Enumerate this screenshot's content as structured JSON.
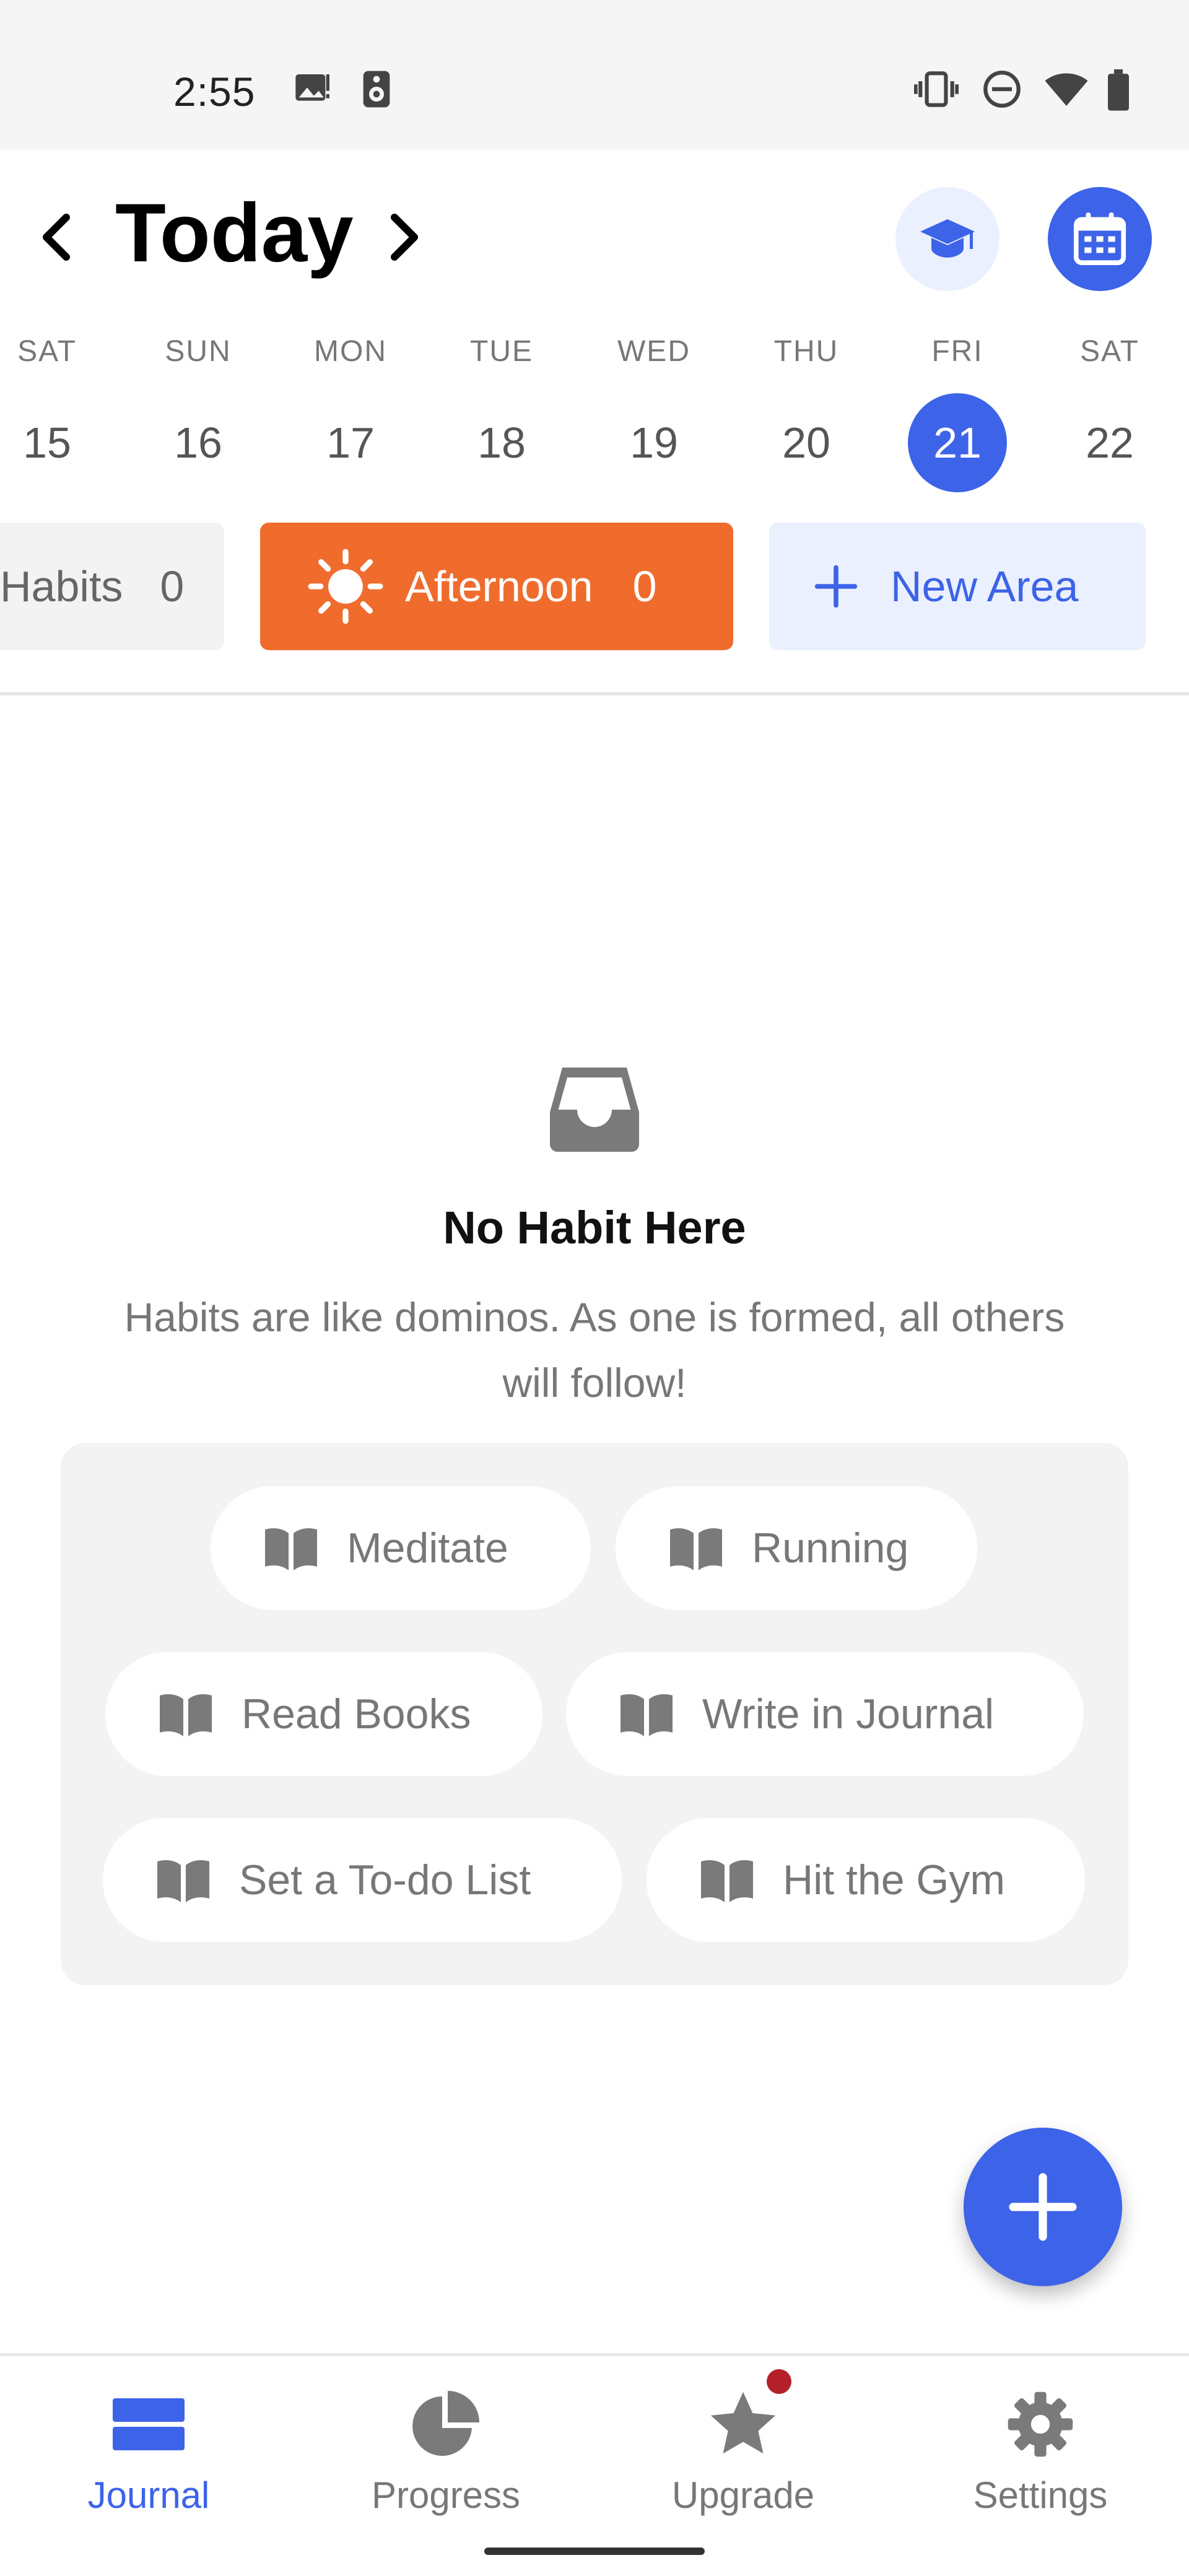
{
  "status_bar": {
    "time": "2:55"
  },
  "header": {
    "title": "Today"
  },
  "week": [
    {
      "name": "SAT",
      "num": "15"
    },
    {
      "name": "SUN",
      "num": "16"
    },
    {
      "name": "MON",
      "num": "17"
    },
    {
      "name": "TUE",
      "num": "18"
    },
    {
      "name": "WED",
      "num": "19"
    },
    {
      "name": "THU",
      "num": "20"
    },
    {
      "name": "FRI",
      "num": "21",
      "selected": true
    },
    {
      "name": "SAT",
      "num": "22"
    }
  ],
  "areas": {
    "habits": {
      "label": "Habits",
      "visible_label": "Habits",
      "count": "0"
    },
    "afternoon": {
      "label": "Afternoon",
      "count": "0"
    },
    "new_area": {
      "label": "New Area"
    }
  },
  "empty_state": {
    "title": "No Habit Here",
    "subtitle": "Habits are like dominos. As one is formed, all others will follow!"
  },
  "suggestions": [
    "Meditate",
    "Running",
    "Read Books",
    "Write in Journal",
    "Set a To-do List",
    "Hit the Gym"
  ],
  "bottom_nav": {
    "journal": "Journal",
    "progress": "Progress",
    "upgrade": "Upgrade",
    "settings": "Settings"
  },
  "colors": {
    "accent": "#3d63e8",
    "afternoon": "#ef6c2d",
    "badge": "#b3202a"
  },
  "icons": {
    "prev": "chevron-left-icon",
    "next": "chevron-right-icon",
    "tutorial": "graduation-cap-icon",
    "calendar": "calendar-icon",
    "afternoon": "sun-icon",
    "add_area": "plus-icon",
    "empty": "inbox-icon",
    "suggestion": "book-icon",
    "fab": "plus-icon",
    "journal": "journal-icon",
    "progress": "pie-chart-icon",
    "upgrade": "star-icon",
    "settings": "gear-icon"
  }
}
